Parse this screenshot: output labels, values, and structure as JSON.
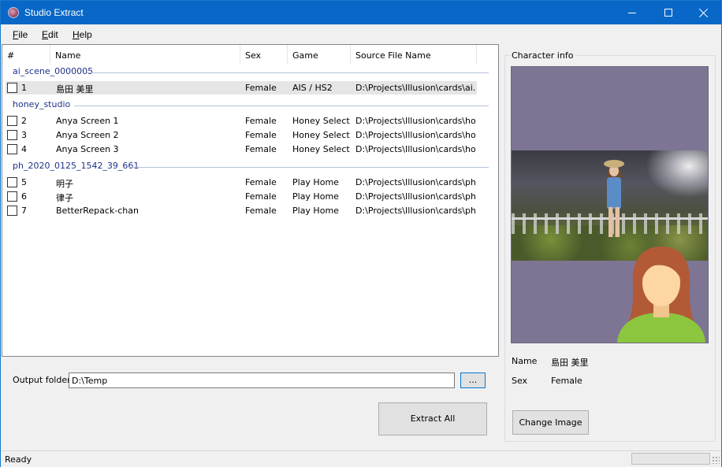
{
  "window": {
    "title": "Studio Extract"
  },
  "menu": {
    "file_u": "F",
    "file_rest": "ile",
    "edit_u": "E",
    "edit_rest": "dit",
    "help_u": "H",
    "help_rest": "elp"
  },
  "table": {
    "columns": [
      "#",
      "Name",
      "Sex",
      "Game",
      "Source File Name"
    ],
    "groups": [
      {
        "name": "ai_scene_0000005",
        "rows": [
          {
            "checked": false,
            "num": "1",
            "name": "島田 美里",
            "sex": "Female",
            "game": "AIS / HS2",
            "source": "D:\\Projects\\Illusion\\cards\\ai...",
            "selected": true
          }
        ]
      },
      {
        "name": "honey_studio",
        "rows": [
          {
            "checked": false,
            "num": "2",
            "name": "Anya Screen 1",
            "sex": "Female",
            "game": "Honey Select",
            "source": "D:\\Projects\\Illusion\\cards\\ho..."
          },
          {
            "checked": false,
            "num": "3",
            "name": "Anya Screen 2",
            "sex": "Female",
            "game": "Honey Select",
            "source": "D:\\Projects\\Illusion\\cards\\ho..."
          },
          {
            "checked": false,
            "num": "4",
            "name": "Anya Screen 3",
            "sex": "Female",
            "game": "Honey Select",
            "source": "D:\\Projects\\Illusion\\cards\\ho..."
          }
        ]
      },
      {
        "name": "ph_2020_0125_1542_39_661",
        "rows": [
          {
            "checked": false,
            "num": "5",
            "name": "明子",
            "sex": "Female",
            "game": "Play Home",
            "source": "D:\\Projects\\Illusion\\cards\\ph..."
          },
          {
            "checked": false,
            "num": "6",
            "name": "律子",
            "sex": "Female",
            "game": "Play Home",
            "source": "D:\\Projects\\Illusion\\cards\\ph..."
          },
          {
            "checked": false,
            "num": "7",
            "name": "BetterRepack-chan",
            "sex": "Female",
            "game": "Play Home",
            "source": "D:\\Projects\\Illusion\\cards\\ph..."
          }
        ]
      }
    ]
  },
  "output": {
    "label": "Output folder",
    "value": "D:\\Temp",
    "browse_label": "...",
    "extract_label": "Extract All"
  },
  "character_info": {
    "title": "Character info",
    "name_label": "Name",
    "name_value": "島田 美里",
    "sex_label": "Sex",
    "sex_value": "Female",
    "change_image_label": "Change Image"
  },
  "status": {
    "text": "Ready",
    "progress": 0
  },
  "colors": {
    "titlebar": "#0867c7",
    "group_header": "#1e3287",
    "preview_bg": "#7e7594",
    "avatar_shirt": "#8cc63f",
    "avatar_hair": "#b25a36",
    "avatar_skin": "#fdd6a4"
  },
  "icons": {
    "app": "app-icon",
    "minimize": "minimize-icon",
    "maximize": "maximize-icon",
    "close": "close-icon",
    "grip": "size-grip-icon"
  }
}
